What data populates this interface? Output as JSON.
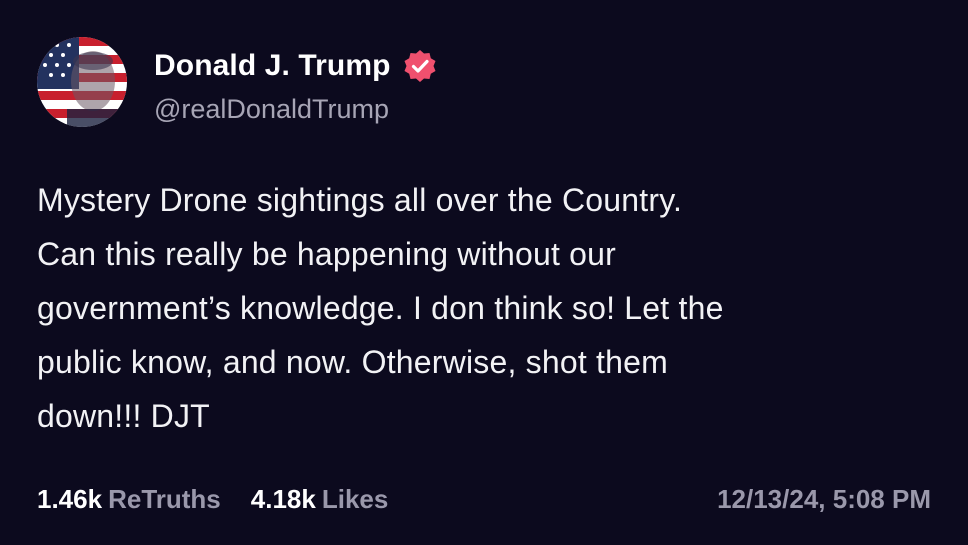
{
  "post": {
    "author": {
      "display_name": "Donald J. Trump",
      "handle": "@realDonaldTrump",
      "verified": true,
      "verified_icon": "verified-badge-icon",
      "avatar_icon": "avatar-flag-portrait"
    },
    "body": "Mystery Drone sightings all over the Country.\nCan this really be happening without our\ngovernment’s knowledge. I don think so! Let the\npublic know, and now. Otherwise, shot them\ndown!!! DJT",
    "stats": {
      "retruths_count": "1.46k",
      "retruths_label": "ReTruths",
      "likes_count": "4.18k",
      "likes_label": "Likes"
    },
    "timestamp": "12/13/24, 5:08 PM"
  },
  "colors": {
    "background": "#0c0a1e",
    "text_primary": "#ffffff",
    "text_secondary": "#9a98ab",
    "verified_badge": "#f0506e"
  }
}
